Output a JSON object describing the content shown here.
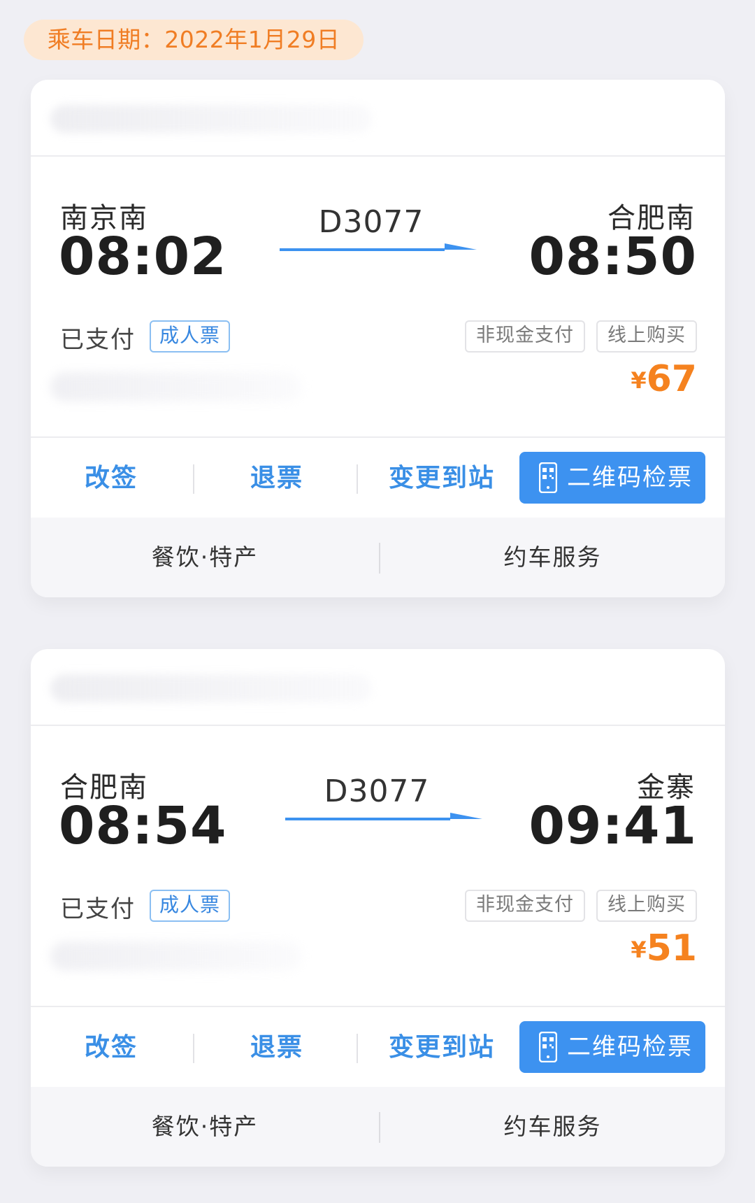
{
  "date_header": {
    "label": "乘车日期：",
    "value": "2022年1月29日"
  },
  "colors": {
    "accent_blue": "#3d92f0",
    "link_blue": "#3a8fe6",
    "price_orange": "#f5821f",
    "date_pill_bg": "#fde7d2",
    "date_pill_text": "#f07d24",
    "page_bg": "#efeff4"
  },
  "tickets": [
    {
      "from_station": "南京南",
      "from_time": "08:02",
      "train_no": "D3077",
      "to_station": "合肥南",
      "to_time": "08:50",
      "status": "已支付",
      "ticket_type": "成人票",
      "tags": [
        "非现金支付",
        "线上购买"
      ],
      "currency": "¥",
      "price": "67",
      "actions": {
        "change": "改签",
        "refund": "退票",
        "change_station": "变更到站",
        "qr_check": "二维码检票"
      },
      "services": {
        "food": "餐饮·特产",
        "car": "约车服务"
      }
    },
    {
      "from_station": "合肥南",
      "from_time": "08:54",
      "train_no": "D3077",
      "to_station": "金寨",
      "to_time": "09:41",
      "status": "已支付",
      "ticket_type": "成人票",
      "tags": [
        "非现金支付",
        "线上购买"
      ],
      "currency": "¥",
      "price": "51",
      "actions": {
        "change": "改签",
        "refund": "退票",
        "change_station": "变更到站",
        "qr_check": "二维码检票"
      },
      "services": {
        "food": "餐饮·特产",
        "car": "约车服务"
      }
    }
  ],
  "icons": {
    "qr_phone": "phone-qr-icon",
    "arrow": "right-arrow-icon"
  }
}
